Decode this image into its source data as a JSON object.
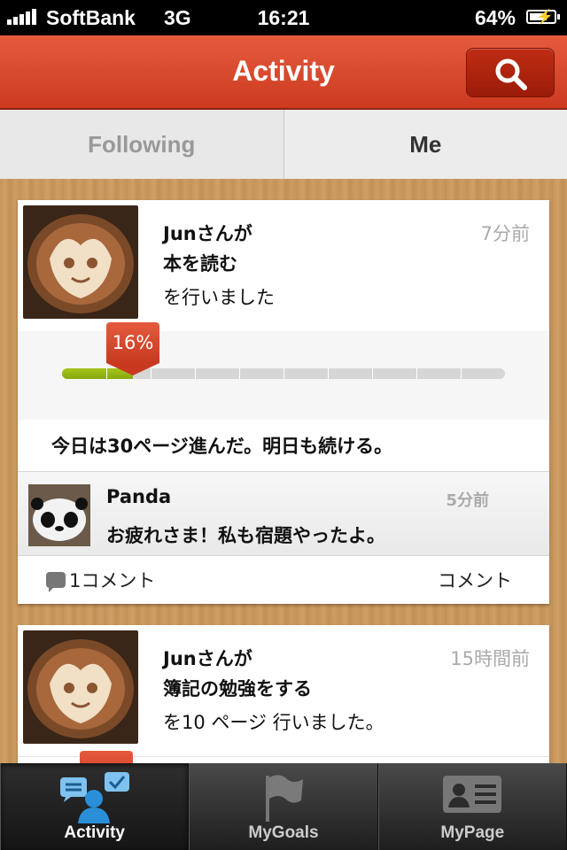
{
  "status_bar": {
    "carrier": "SoftBank",
    "network": "3G",
    "time": "16:21",
    "battery": "64%"
  },
  "header": {
    "title": "Activity"
  },
  "segmented": {
    "following": "Following",
    "me": "Me"
  },
  "feed": [
    {
      "user_line": "Junさんが",
      "goal": "本を読む",
      "did": "を行いました",
      "time_ago": "7分前",
      "progress_label": "16%",
      "progress_value": 0.16,
      "note": "今日は30ページ進んだ。明日も続ける。",
      "comment": {
        "name": "Panda",
        "time": "5分前",
        "text": "お疲れさま！私も宿題やったよ。"
      },
      "comment_count": "1コメント",
      "comment_action": "コメント"
    },
    {
      "user_line": "Junさんが",
      "goal": "簿記の勉強をする",
      "did": "を10  ページ 行いました。",
      "time_ago": "15時間前"
    }
  ],
  "tabbar": [
    {
      "label": "Activity",
      "icon": "activity-people-icon"
    },
    {
      "label": "MyGoals",
      "icon": "flag-icon"
    },
    {
      "label": "MyPage",
      "icon": "profile-card-icon"
    }
  ],
  "colors": {
    "accent": "#d9472c",
    "progress": "#9bbb14",
    "tab_active": "#2a8fd8"
  }
}
